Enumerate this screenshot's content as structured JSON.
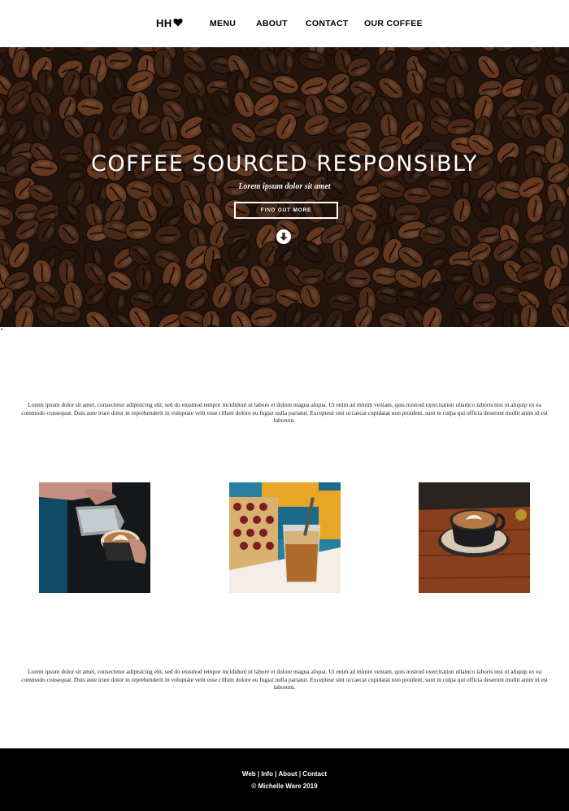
{
  "nav": {
    "logo_text": "HH",
    "items": [
      "MENU",
      "ABOUT",
      "CONTACT",
      "OUR COFFEE"
    ]
  },
  "hero": {
    "title": "COFFEE SOURCED RESPONSIBLY",
    "subtitle": "Lorem ipsum dolor sit amet",
    "button_label": "FIND OUT MORE",
    "arrow_icon": "arrow-down-circle-icon"
  },
  "content": {
    "paragraph1": "Lorem ipsum dolor sit amet, consectetur adipisicing elit, sed do eiusmod tempor incididunt ut labore et dolore magna aliqua. Ut enim ad minim veniam, quis nostrud exercitation ullamco laboris nisi ut aliquip ex ea commodo consequat. Duis aute irure dolor in reprehenderit in voluptate velit esse cillum dolore eu fugiat nulla pariatur. Excepteur sint occaecat cupidatat non proident, sunt in culpa qui officia deserunt mollit anim id est laborum.",
    "paragraph2": "Lorem ipsum dolor sit amet, consectetur adipisicing elit, sed do eiusmod tempor incididunt ut labore et dolore magna aliqua. Ut enim ad minim veniam, quis nostrud exercitation ullamco laboris nisi ut aliquip ex ea commodo consequat. Duis aute irure dolor in reprehenderit in voluptate velit esse cillum dolore eu fugiat nulla pariatur. Excepteur sint occaecat cupidatat non proident, sunt in culpa qui officia deserunt mollit anim id est laborum."
  },
  "footer": {
    "links": [
      "Web",
      "Info",
      "About",
      "Contact"
    ],
    "separator": "|",
    "copyright": "© Michelle Ware 2019"
  },
  "colors": {
    "footer_bg": "#000000",
    "hero_bean": "#5a3320"
  }
}
